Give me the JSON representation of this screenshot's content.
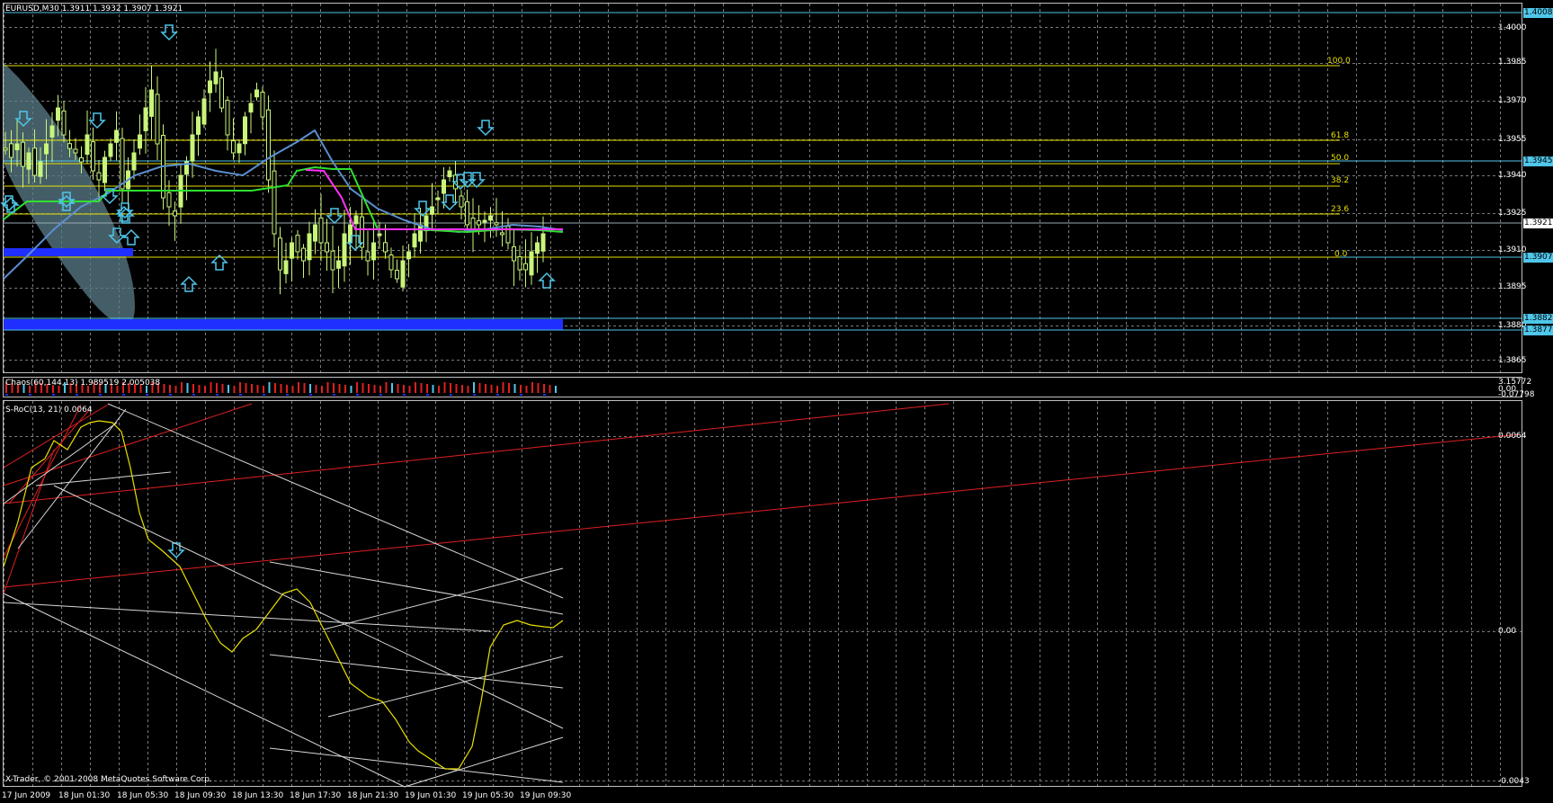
{
  "main_window": {
    "title": "EURUSD,M30  1.3911 1.3932 1.3907 1.3921",
    "price_axis": [
      "1.4000",
      "1.3985",
      "1.3970",
      "1.3955",
      "1.3940",
      "1.3925",
      "1.3910",
      "1.3895",
      "1.3880",
      "1.3865"
    ],
    "price_boxes": [
      {
        "label": "1.4008",
        "color": "#4fc6ea",
        "text_color": "#000"
      },
      {
        "label": "1.3945",
        "color": "#4fc6ea",
        "text_color": "#000"
      },
      {
        "label": "1.3921",
        "color": "#ffffff",
        "text_color": "#000"
      },
      {
        "label": "1.3907",
        "color": "#4fc6ea",
        "text_color": "#000"
      },
      {
        "label": "1.3882",
        "color": "#4fc6ea",
        "text_color": "#000"
      },
      {
        "label": "1.3877",
        "color": "#4fc6ea",
        "text_color": "#000"
      }
    ],
    "fibo_levels": [
      "100.0",
      "61.8",
      "50.0",
      "38.2",
      "23.6",
      "0.0"
    ]
  },
  "chaos_window": {
    "title": "Chaos(60,144,13) 1.989519 2.005038",
    "axis": [
      "3.15772",
      "0.00",
      "-0.07798"
    ]
  },
  "sroc_window": {
    "title": "S-RoC(13, 21) 0.0064",
    "axis": [
      "0.0064",
      "0.00",
      "-0.0043"
    ]
  },
  "time_axis": [
    "17 Jun 2009",
    "18 Jun 01:30",
    "18 Jun 05:30",
    "18 Jun 09:30",
    "18 Jun 13:30",
    "18 Jun 17:30",
    "18 Jun 21:30",
    "19 Jun 01:30",
    "19 Jun 05:30",
    "19 Jun 09:30"
  ],
  "footer": {
    "copyright": "X-Trader, © 2001-2008 MetaQuotes Software Corp."
  },
  "colors": {
    "background": "#000000",
    "grid": "#8a8a8a",
    "bull": "#c8f57a",
    "fibo": "#e8e000",
    "cyan": "#4fc6ea",
    "ma_blue": "#5a8fd0",
    "ma_green": "#30e030",
    "ma_magenta": "#ff30ff",
    "sroc": "#e8e000",
    "trend_red": "#e02020",
    "trend_white": "#d8d8d8",
    "band_blue": "#1f2fff"
  }
}
